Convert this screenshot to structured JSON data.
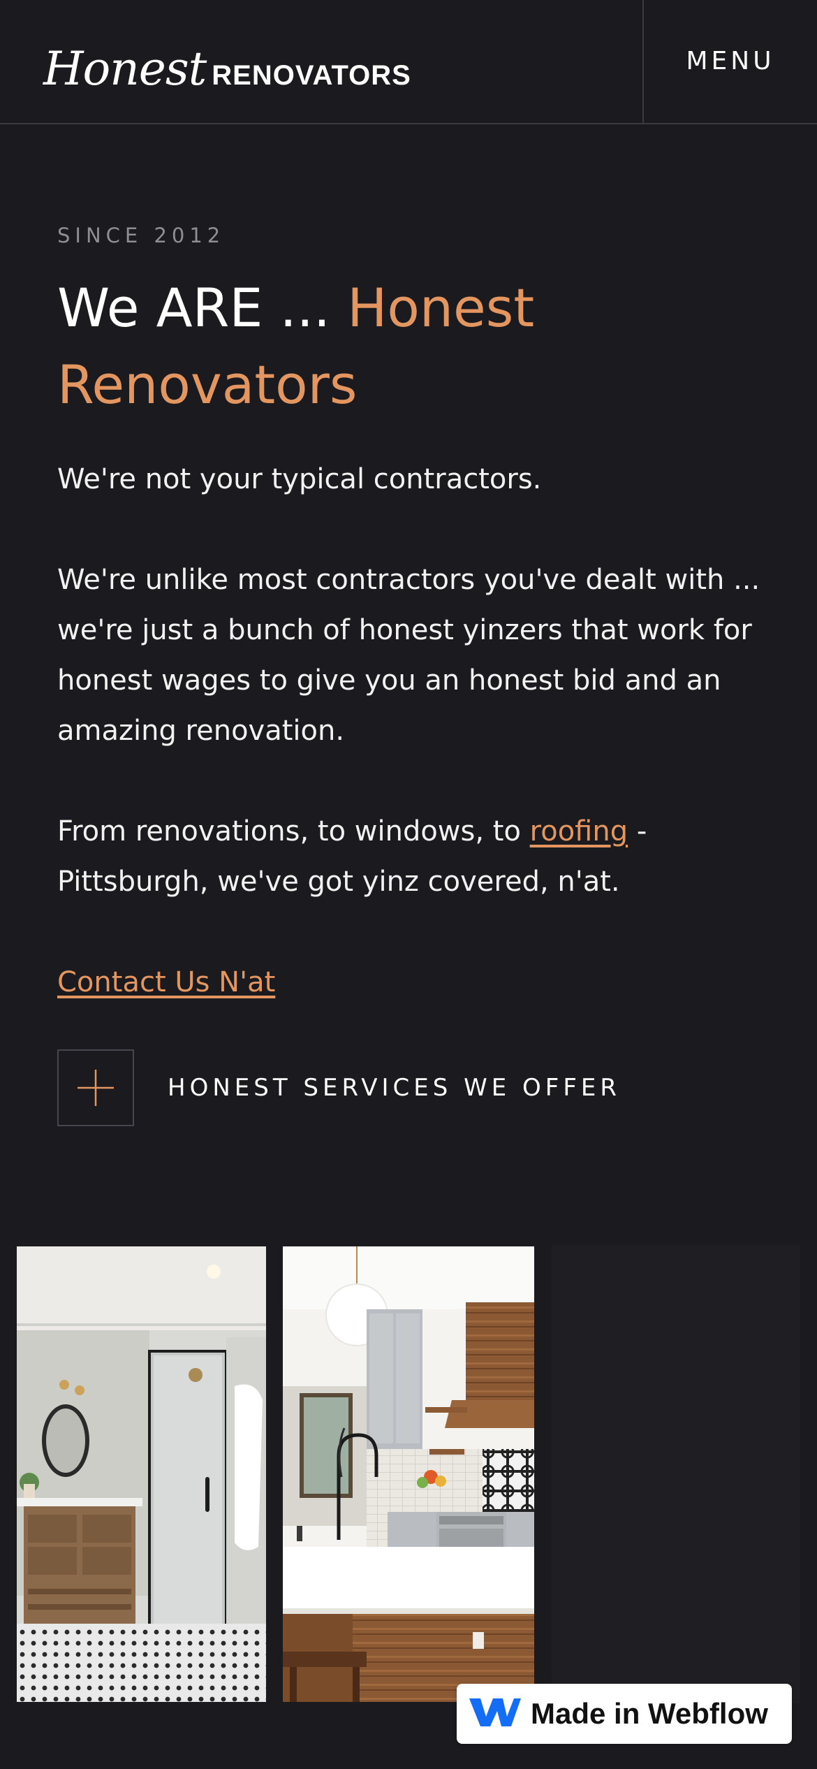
{
  "header": {
    "logo_script": "Honest",
    "logo_caps": "RENOVATORS",
    "menu_label": "MENU"
  },
  "hero": {
    "eyebrow": "SINCE 2012",
    "headline_plain": "We ARE ... ",
    "headline_accent": "Honest Renovators",
    "para1": "We're not your typical contractors.",
    "para2": "We're unlike most contractors you've dealt with ... we're just a bunch of honest yinzers that work for honest wages to give you an honest bid and an amazing renovation.",
    "para3_before": "From renovations, to windows, to ",
    "para3_link": "roofing",
    "para3_after": " - Pittsburgh, we've got yinz covered, n'at.",
    "contact_link": "Contact Us N'at"
  },
  "services": {
    "label": "HONEST SERVICES WE OFFER",
    "icon": "plus-icon"
  },
  "gallery": {
    "images": [
      "bathroom-photo",
      "kitchen-photo"
    ]
  },
  "badge": {
    "label": "Made in Webflow",
    "icon": "webflow-logo-icon"
  },
  "colors": {
    "background": "#1b1b1f",
    "accent": "#e3965f",
    "text": "#f2f2f2",
    "muted": "#8e8e93"
  }
}
